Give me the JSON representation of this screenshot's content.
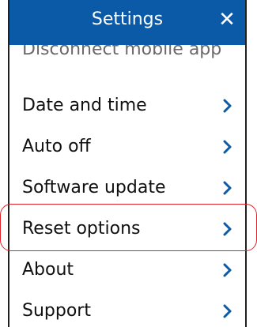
{
  "header": {
    "title": "Settings",
    "close_icon": "close-icon"
  },
  "partial_item": {
    "label": "Disconnect mobile app"
  },
  "menu": {
    "items": [
      {
        "label": "Date and time",
        "icon": "chevron-right-icon"
      },
      {
        "label": "Auto off",
        "icon": "chevron-right-icon"
      },
      {
        "label": "Software update",
        "icon": "chevron-right-icon"
      },
      {
        "label": "Reset options",
        "icon": "chevron-right-icon",
        "highlighted": true
      },
      {
        "label": "About",
        "icon": "chevron-right-icon"
      },
      {
        "label": "Support",
        "icon": "chevron-right-icon"
      }
    ]
  },
  "colors": {
    "header_bg": "#0a5aa8",
    "chevron": "#0a5aa8",
    "highlight": "#e2222a",
    "text": "#111111"
  }
}
